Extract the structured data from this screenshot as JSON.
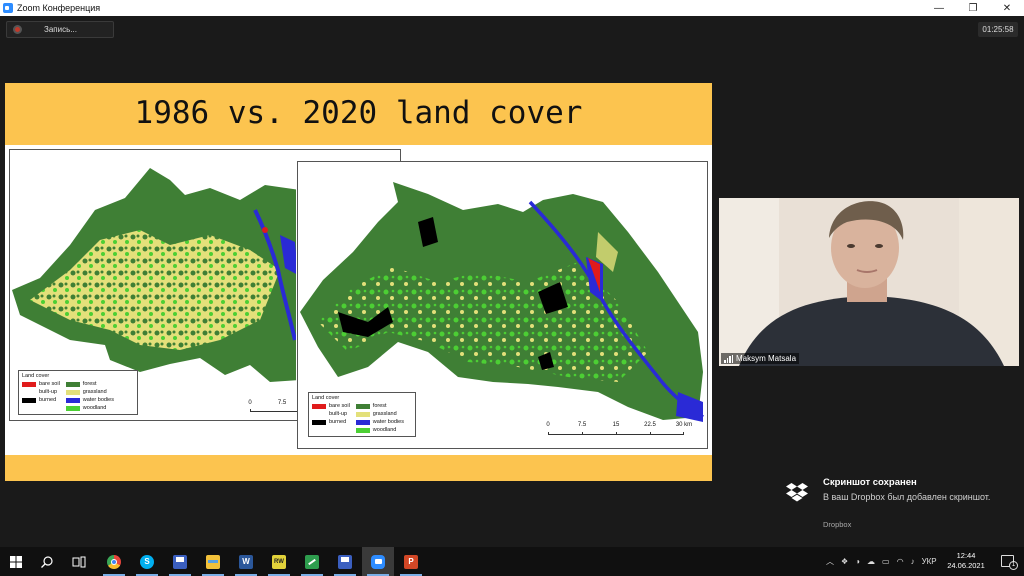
{
  "window": {
    "title": "Zoom Конференция",
    "minimize": "—",
    "restore": "❐",
    "close": "✕"
  },
  "recording": {
    "label": "Запись..."
  },
  "timer": {
    "value": "01:25:58"
  },
  "slide": {
    "title": "1986 vs. 2020 land cover",
    "legend_title": "Land cover",
    "legend": {
      "left": [
        {
          "label": "bare soil",
          "color": "#e01b1b"
        },
        {
          "label": "built-up",
          "color": "#ffffff"
        },
        {
          "label": "burned",
          "color": "#000000"
        }
      ],
      "right": [
        {
          "label": "forest",
          "color": "#3f7f35"
        },
        {
          "label": "grassland",
          "color": "#e3e07a"
        },
        {
          "label": "water bodies",
          "color": "#2a2ad6"
        },
        {
          "label": "woodland",
          "color": "#4ccf34"
        }
      ]
    },
    "scale_back": {
      "ticks": [
        "0",
        "7.5"
      ]
    },
    "scale_front": {
      "ticks": [
        "0",
        "7.5",
        "15",
        "22.5",
        "30 km"
      ]
    }
  },
  "participant": {
    "name": "Maksym Matsala"
  },
  "toast": {
    "title": "Скриншот сохранен",
    "message": "В ваш Dropbox был добавлен скриншот.",
    "source": "Dropbox"
  },
  "taskbar": {
    "items": [
      {
        "name": "start-icon",
        "color": "#ffffff"
      },
      {
        "name": "search-icon",
        "color": "#ffffff"
      },
      {
        "name": "task-view-icon",
        "color": "#ffffff"
      },
      {
        "name": "chrome-icon",
        "color": "#e8453c"
      },
      {
        "name": "skype-icon",
        "color": "#00aff0",
        "glyph": "S"
      },
      {
        "name": "save-app-icon",
        "color": "#3b5fc0"
      },
      {
        "name": "file-explorer-icon",
        "color": "#f3c13a"
      },
      {
        "name": "word-icon",
        "color": "#2b579a",
        "glyph": "W"
      },
      {
        "name": "yellow-app-icon",
        "color": "#e2d23a",
        "glyph": "RW"
      },
      {
        "name": "green-app-icon",
        "color": "#2e9d4e"
      },
      {
        "name": "save-app-2-icon",
        "color": "#3b5fc0"
      },
      {
        "name": "zoom-icon",
        "color": "#2d8cff"
      },
      {
        "name": "powerpoint-icon",
        "color": "#d24726",
        "glyph": "P"
      }
    ],
    "language": "УКР",
    "time": "12:44",
    "date": "24.06.2021",
    "notifications": "1"
  }
}
